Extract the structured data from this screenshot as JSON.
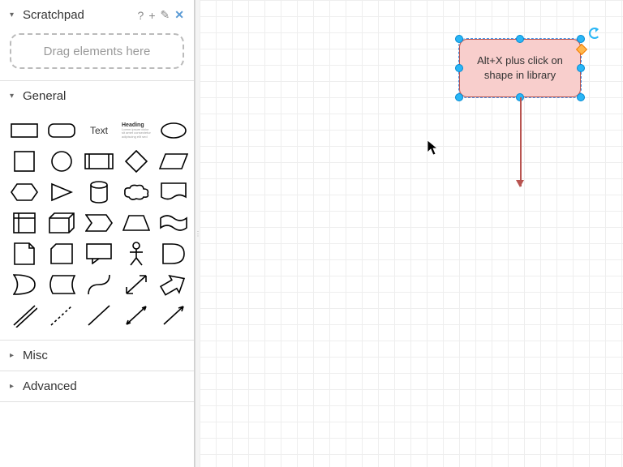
{
  "sections": {
    "scratchpad": {
      "title": "Scratchpad",
      "dropHint": "Drag elements here",
      "expanded": true
    },
    "general": {
      "title": "General",
      "expanded": true
    },
    "misc": {
      "title": "Misc",
      "expanded": false
    },
    "advanced": {
      "title": "Advanced",
      "expanded": false
    }
  },
  "preview": {
    "textLabel": "Text",
    "headingLabel": "Heading"
  },
  "canvas": {
    "shape": {
      "text": "Alt+X plus click on shape in library",
      "fill": "#f8cecc",
      "stroke": "#b85450"
    }
  }
}
